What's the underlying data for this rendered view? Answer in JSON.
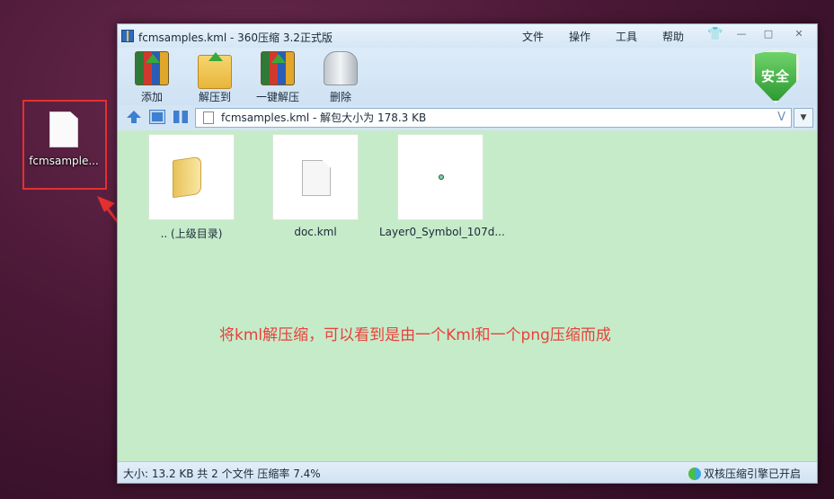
{
  "desktop": {
    "file_label": "fcmsample..."
  },
  "annotation": {
    "text": "将kml解压缩，可以看到是由一个Kml和一个png压缩而成"
  },
  "window": {
    "title": "fcmsamples.kml - 360压缩 3.2正式版",
    "menu": [
      "文件",
      "操作",
      "工具",
      "帮助"
    ],
    "controls": {
      "minimize": "—",
      "restore": "□",
      "close": "✕"
    },
    "toolbar": {
      "add": "添加",
      "extract_to": "解压到",
      "one_click_extract": "一键解压",
      "delete": "删除"
    },
    "security_badge": "安全",
    "address": "fcmsamples.kml - 解包大小为 178.3 KB",
    "address_dropdown": "▼",
    "items": [
      {
        "label": ".. (上级目录)",
        "icon": "folder-icon"
      },
      {
        "label": "doc.kml",
        "icon": "document-icon"
      },
      {
        "label": "Layer0_Symbol_107d...",
        "icon": "png-thumb"
      }
    ],
    "status_left": "大小: 13.2 KB 共 2 个文件 压缩率 7.4%",
    "status_right": "双核压缩引擎已开启"
  },
  "colors": {
    "content_bg": "#c6ebc9",
    "annotation": "#e8413a",
    "highlight_box": "#e53030"
  }
}
